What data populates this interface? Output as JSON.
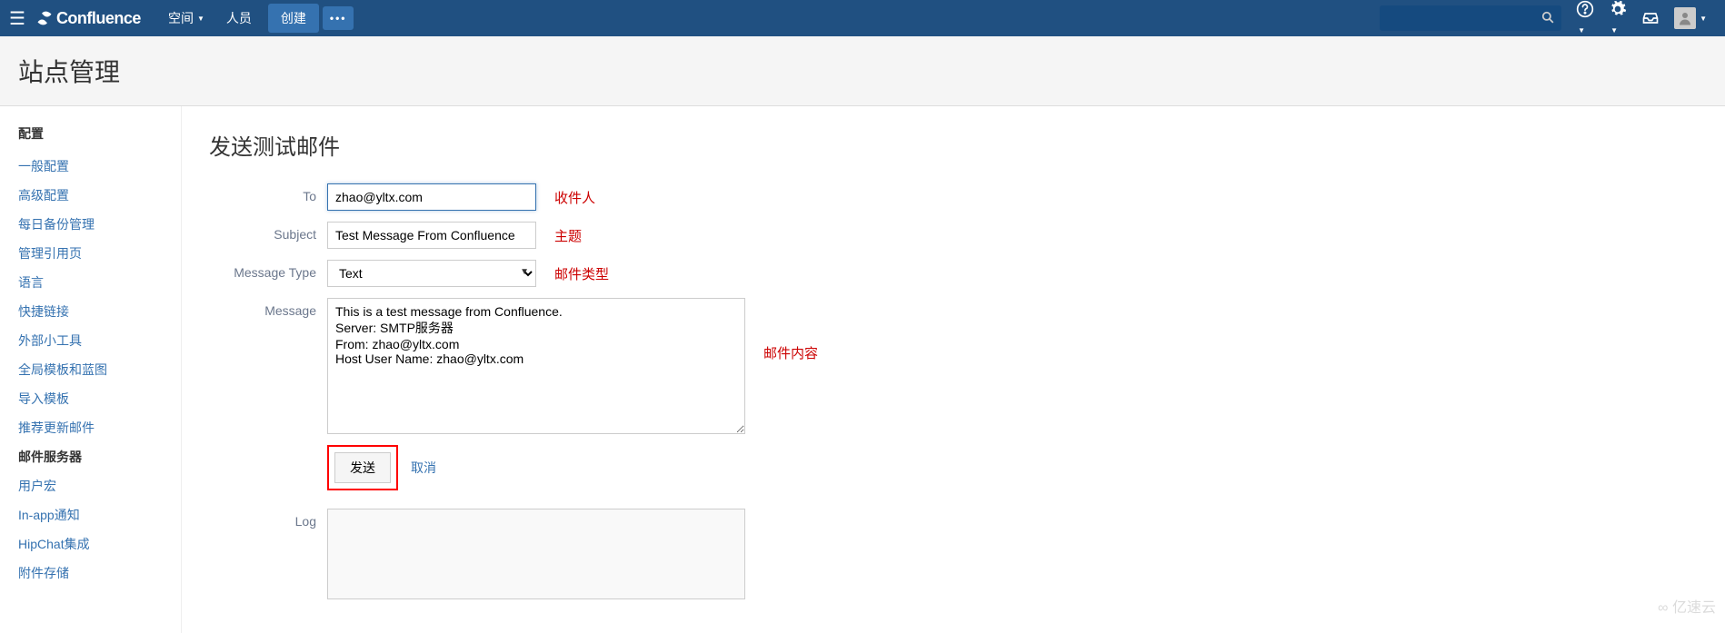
{
  "nav": {
    "brand": "Confluence",
    "spaces": "空间",
    "people": "人员",
    "create": "创建",
    "more": "•••"
  },
  "header": {
    "title": "站点管理"
  },
  "sidebar": {
    "heading": "配置",
    "items": [
      {
        "label": "一般配置",
        "active": false
      },
      {
        "label": "高级配置",
        "active": false
      },
      {
        "label": "每日备份管理",
        "active": false
      },
      {
        "label": "管理引用页",
        "active": false
      },
      {
        "label": "语言",
        "active": false
      },
      {
        "label": "快捷链接",
        "active": false
      },
      {
        "label": "外部小工具",
        "active": false
      },
      {
        "label": "全局模板和蓝图",
        "active": false
      },
      {
        "label": "导入模板",
        "active": false
      },
      {
        "label": "推荐更新邮件",
        "active": false
      },
      {
        "label": "邮件服务器",
        "active": true
      },
      {
        "label": "用户宏",
        "active": false
      },
      {
        "label": "In-app通知",
        "active": false
      },
      {
        "label": "HipChat集成",
        "active": false
      },
      {
        "label": "附件存储",
        "active": false
      }
    ]
  },
  "form": {
    "title": "发送测试邮件",
    "labels": {
      "to": "To",
      "subject": "Subject",
      "messageType": "Message Type",
      "message": "Message",
      "log": "Log"
    },
    "values": {
      "to": "zhao@yltx.com",
      "subject": "Test Message From Confluence",
      "messageType": "Text",
      "message": "This is a test message from Confluence.\nServer: SMTP服务器\nFrom: zhao@yltx.com\nHost User Name: zhao@yltx.com"
    },
    "annotations": {
      "to": "收件人",
      "subject": "主题",
      "messageType": "邮件类型",
      "message": "邮件内容"
    },
    "buttons": {
      "send": "发送",
      "cancel": "取消"
    }
  },
  "watermark": "亿速云"
}
